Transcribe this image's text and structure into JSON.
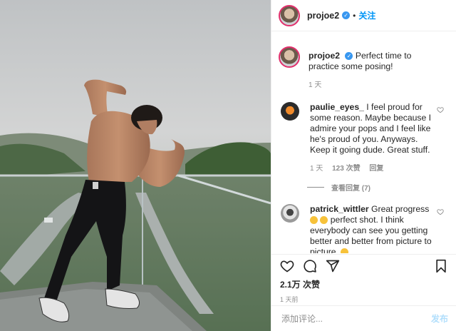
{
  "header": {
    "username": "projoe2",
    "verified_mark": "✓",
    "separator": "•",
    "follow_label": "关注"
  },
  "caption": {
    "username": "projoe2",
    "text": "Perfect time to practice some posing!",
    "time": "1 天"
  },
  "comments": [
    {
      "username": "paulie_eyes_",
      "text": "I feel proud for some reason. Maybe because I admire your pops and I feel like he's proud of you. Anyways. Keep it going dude. Great stuff.",
      "time": "1 天",
      "likes": "123 次赞",
      "reply": "回复",
      "view_replies": "查看回复 (7)"
    },
    {
      "username": "patrick_wittler",
      "text_a": "Great progress",
      "text_b": "perfect shot. I think everybody can see you getting better and better from picture to picture.",
      "emoji_1": "sunglasses-emoji",
      "emoji_2": "ok-hand-emoji",
      "emoji_3": "flexed-biceps-emoji"
    }
  ],
  "stats": {
    "likes": "2.1万 次赞",
    "time_ago": "1 天前"
  },
  "comment_box": {
    "placeholder": "添加评论...",
    "post_label": "发布"
  },
  "icons": [
    "heart-icon",
    "comment-icon",
    "share-icon",
    "bookmark-icon",
    "verified-badge-icon"
  ],
  "colors": {
    "accent": "#0095f6",
    "muted": "#8e8e8e",
    "text": "#262626",
    "border": "#efefef"
  }
}
